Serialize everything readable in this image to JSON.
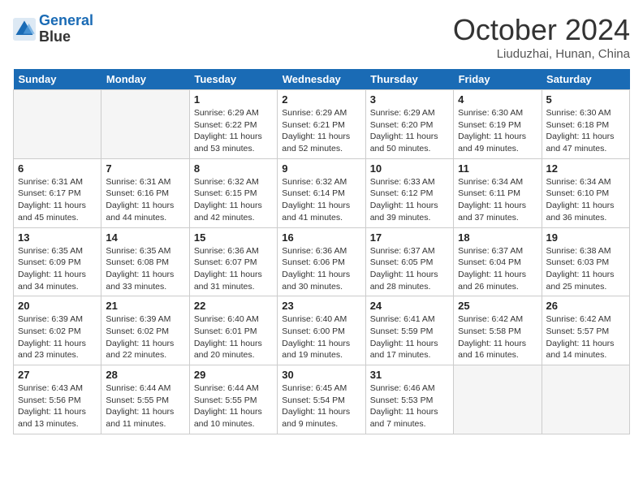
{
  "header": {
    "logo_line1": "General",
    "logo_line2": "Blue",
    "month": "October 2024",
    "location": "Liuduzhai, Hunan, China"
  },
  "days_of_week": [
    "Sunday",
    "Monday",
    "Tuesday",
    "Wednesday",
    "Thursday",
    "Friday",
    "Saturday"
  ],
  "weeks": [
    [
      {
        "day": "",
        "empty": true
      },
      {
        "day": "",
        "empty": true
      },
      {
        "day": "1",
        "sunrise": "6:29 AM",
        "sunset": "6:22 PM",
        "daylight": "11 hours and 53 minutes."
      },
      {
        "day": "2",
        "sunrise": "6:29 AM",
        "sunset": "6:21 PM",
        "daylight": "11 hours and 52 minutes."
      },
      {
        "day": "3",
        "sunrise": "6:29 AM",
        "sunset": "6:20 PM",
        "daylight": "11 hours and 50 minutes."
      },
      {
        "day": "4",
        "sunrise": "6:30 AM",
        "sunset": "6:19 PM",
        "daylight": "11 hours and 49 minutes."
      },
      {
        "day": "5",
        "sunrise": "6:30 AM",
        "sunset": "6:18 PM",
        "daylight": "11 hours and 47 minutes."
      }
    ],
    [
      {
        "day": "6",
        "sunrise": "6:31 AM",
        "sunset": "6:17 PM",
        "daylight": "11 hours and 45 minutes."
      },
      {
        "day": "7",
        "sunrise": "6:31 AM",
        "sunset": "6:16 PM",
        "daylight": "11 hours and 44 minutes."
      },
      {
        "day": "8",
        "sunrise": "6:32 AM",
        "sunset": "6:15 PM",
        "daylight": "11 hours and 42 minutes."
      },
      {
        "day": "9",
        "sunrise": "6:32 AM",
        "sunset": "6:14 PM",
        "daylight": "11 hours and 41 minutes."
      },
      {
        "day": "10",
        "sunrise": "6:33 AM",
        "sunset": "6:12 PM",
        "daylight": "11 hours and 39 minutes."
      },
      {
        "day": "11",
        "sunrise": "6:34 AM",
        "sunset": "6:11 PM",
        "daylight": "11 hours and 37 minutes."
      },
      {
        "day": "12",
        "sunrise": "6:34 AM",
        "sunset": "6:10 PM",
        "daylight": "11 hours and 36 minutes."
      }
    ],
    [
      {
        "day": "13",
        "sunrise": "6:35 AM",
        "sunset": "6:09 PM",
        "daylight": "11 hours and 34 minutes."
      },
      {
        "day": "14",
        "sunrise": "6:35 AM",
        "sunset": "6:08 PM",
        "daylight": "11 hours and 33 minutes."
      },
      {
        "day": "15",
        "sunrise": "6:36 AM",
        "sunset": "6:07 PM",
        "daylight": "11 hours and 31 minutes."
      },
      {
        "day": "16",
        "sunrise": "6:36 AM",
        "sunset": "6:06 PM",
        "daylight": "11 hours and 30 minutes."
      },
      {
        "day": "17",
        "sunrise": "6:37 AM",
        "sunset": "6:05 PM",
        "daylight": "11 hours and 28 minutes."
      },
      {
        "day": "18",
        "sunrise": "6:37 AM",
        "sunset": "6:04 PM",
        "daylight": "11 hours and 26 minutes."
      },
      {
        "day": "19",
        "sunrise": "6:38 AM",
        "sunset": "6:03 PM",
        "daylight": "11 hours and 25 minutes."
      }
    ],
    [
      {
        "day": "20",
        "sunrise": "6:39 AM",
        "sunset": "6:02 PM",
        "daylight": "11 hours and 23 minutes."
      },
      {
        "day": "21",
        "sunrise": "6:39 AM",
        "sunset": "6:02 PM",
        "daylight": "11 hours and 22 minutes."
      },
      {
        "day": "22",
        "sunrise": "6:40 AM",
        "sunset": "6:01 PM",
        "daylight": "11 hours and 20 minutes."
      },
      {
        "day": "23",
        "sunrise": "6:40 AM",
        "sunset": "6:00 PM",
        "daylight": "11 hours and 19 minutes."
      },
      {
        "day": "24",
        "sunrise": "6:41 AM",
        "sunset": "5:59 PM",
        "daylight": "11 hours and 17 minutes."
      },
      {
        "day": "25",
        "sunrise": "6:42 AM",
        "sunset": "5:58 PM",
        "daylight": "11 hours and 16 minutes."
      },
      {
        "day": "26",
        "sunrise": "6:42 AM",
        "sunset": "5:57 PM",
        "daylight": "11 hours and 14 minutes."
      }
    ],
    [
      {
        "day": "27",
        "sunrise": "6:43 AM",
        "sunset": "5:56 PM",
        "daylight": "11 hours and 13 minutes."
      },
      {
        "day": "28",
        "sunrise": "6:44 AM",
        "sunset": "5:55 PM",
        "daylight": "11 hours and 11 minutes."
      },
      {
        "day": "29",
        "sunrise": "6:44 AM",
        "sunset": "5:55 PM",
        "daylight": "11 hours and 10 minutes."
      },
      {
        "day": "30",
        "sunrise": "6:45 AM",
        "sunset": "5:54 PM",
        "daylight": "11 hours and 9 minutes."
      },
      {
        "day": "31",
        "sunrise": "6:46 AM",
        "sunset": "5:53 PM",
        "daylight": "11 hours and 7 minutes."
      },
      {
        "day": "",
        "empty": true
      },
      {
        "day": "",
        "empty": true
      }
    ]
  ],
  "labels": {
    "sunrise": "Sunrise:",
    "sunset": "Sunset:",
    "daylight": "Daylight:"
  }
}
